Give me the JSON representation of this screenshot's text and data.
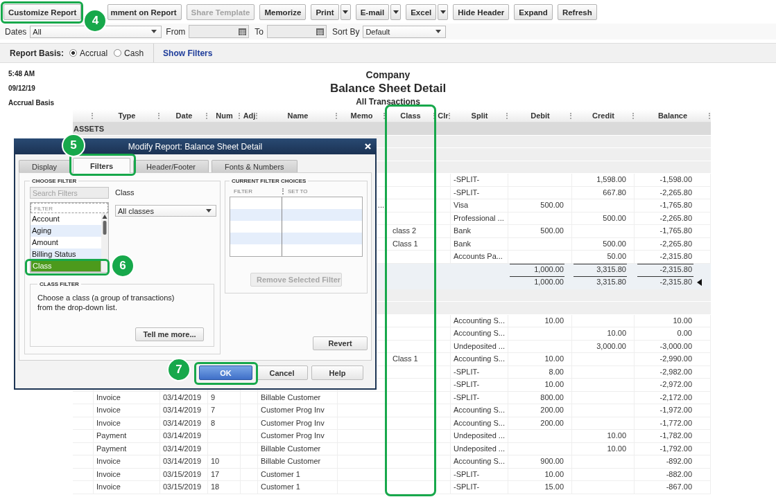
{
  "toolbar": {
    "buttons": [
      {
        "label": "Customize Report",
        "kind": "plain",
        "disabled": false,
        "highlighted": true,
        "step": "4"
      },
      {
        "label": "mment on Report",
        "kind": "plain",
        "disabled": false,
        "highlighted": false
      },
      {
        "label": "Share Template",
        "kind": "plain",
        "disabled": true,
        "highlighted": false
      },
      {
        "label": "Memorize",
        "kind": "plain",
        "disabled": false,
        "highlighted": false
      },
      {
        "label": "Print",
        "kind": "split",
        "disabled": false,
        "highlighted": false
      },
      {
        "label": "E-mail",
        "kind": "split",
        "disabled": false,
        "highlighted": false
      },
      {
        "label": "Excel",
        "kind": "split",
        "disabled": false,
        "highlighted": false
      },
      {
        "label": "Hide Header",
        "kind": "plain",
        "disabled": false,
        "highlighted": false
      },
      {
        "label": "Expand",
        "kind": "plain",
        "disabled": false,
        "highlighted": false
      },
      {
        "label": "Refresh",
        "kind": "plain",
        "disabled": false,
        "highlighted": false
      }
    ]
  },
  "filter_bar": {
    "dates": {
      "label": "Dates",
      "value": "All"
    },
    "from": {
      "label": "From"
    },
    "to": {
      "label": "To"
    },
    "sort_by": {
      "label": "Sort By",
      "value": "Default"
    }
  },
  "report_basis": {
    "label": "Report Basis:",
    "options": [
      {
        "label": "Accrual",
        "selected": true
      },
      {
        "label": "Cash",
        "selected": false
      }
    ],
    "link": "Show Filters"
  },
  "report": {
    "time": "5:48 AM",
    "date": "09/12/19",
    "basis": "Accrual Basis",
    "company": "Company",
    "title": "Balance Sheet Detail",
    "subtitle": "All Transactions"
  },
  "table": {
    "columns": [
      {
        "label": "Type",
        "highlighted": false
      },
      {
        "label": "Date",
        "highlighted": false
      },
      {
        "label": "Num",
        "highlighted": false
      },
      {
        "label": "Adj",
        "highlighted": false
      },
      {
        "label": "Name",
        "highlighted": false
      },
      {
        "label": "Memo",
        "highlighted": false
      },
      {
        "label": "Class",
        "highlighted": true
      },
      {
        "label": "Clr",
        "highlighted": false
      },
      {
        "label": "Split",
        "highlighted": false
      },
      {
        "label": "Debit",
        "highlighted": false
      },
      {
        "label": "Credit",
        "highlighted": false
      },
      {
        "label": "Balance",
        "highlighted": false
      }
    ],
    "rows": [
      {
        "kind": "section",
        "label": "ASSETS"
      },
      {
        "kind": "group"
      },
      {
        "kind": "group"
      },
      {
        "kind": "group"
      },
      {
        "kind": "detail",
        "split": "-SPLIT-",
        "credit": "1,598.00",
        "balance": "-1,598.00"
      },
      {
        "kind": "detail",
        "split": "-SPLIT-",
        "credit": "667.80",
        "balance": "-2,265.80"
      },
      {
        "kind": "detail",
        "memo": "...",
        "split": "Visa",
        "debit": "500.00",
        "balance": "-1,765.80"
      },
      {
        "kind": "detail",
        "split": "Professional ...",
        "credit": "500.00",
        "balance": "-2,265.80"
      },
      {
        "kind": "detail",
        "class": "class 2",
        "split": "Bank",
        "debit": "500.00",
        "balance": "-1,765.80"
      },
      {
        "kind": "detail",
        "class": "Class 1",
        "split": "Bank",
        "credit": "500.00",
        "balance": "-2,265.80"
      },
      {
        "kind": "detail",
        "split": "Accounts Pa...",
        "credit": "50.00",
        "balance": "-2,315.80"
      },
      {
        "kind": "subtotal",
        "debit": "1,000.00",
        "credit": "3,315.80",
        "balance": "-2,315.80"
      },
      {
        "kind": "total",
        "debit": "1,000.00",
        "credit": "3,315.80",
        "balance": "-2,315.80"
      },
      {
        "kind": "group"
      },
      {
        "kind": "group"
      },
      {
        "kind": "detail",
        "split": "Accounting S...",
        "debit": "10.00",
        "balance": "10.00"
      },
      {
        "kind": "detail",
        "split": "Accounting S...",
        "credit": "10.00",
        "balance": "0.00"
      },
      {
        "kind": "detail",
        "split": "Undeposited ...",
        "credit": "3,000.00",
        "balance": "-3,000.00"
      },
      {
        "kind": "detail",
        "class": "Class 1",
        "split": "Accounting S...",
        "debit": "10.00",
        "balance": "-2,990.00"
      },
      {
        "kind": "detail",
        "split": "-SPLIT-",
        "debit": "8.00",
        "balance": "-2,982.00"
      },
      {
        "kind": "detail",
        "split": "-SPLIT-",
        "debit": "10.00",
        "balance": "-2,972.00"
      },
      {
        "kind": "detail",
        "type": "Invoice",
        "date": "03/14/2019",
        "num": "9",
        "name": "Billable Customer",
        "split": "-SPLIT-",
        "debit": "800.00",
        "balance": "-2,172.00"
      },
      {
        "kind": "detail",
        "type": "Invoice",
        "date": "03/14/2019",
        "num": "7",
        "name": "Customer Prog Inv",
        "split": "Accounting S...",
        "debit": "200.00",
        "balance": "-1,972.00"
      },
      {
        "kind": "detail",
        "type": "Invoice",
        "date": "03/14/2019",
        "num": "8",
        "name": "Customer Prog Inv",
        "split": "Accounting S...",
        "debit": "200.00",
        "balance": "-1,772.00"
      },
      {
        "kind": "detail",
        "type": "Payment",
        "date": "03/14/2019",
        "name": "Customer Prog Inv",
        "split": "Undeposited ...",
        "credit": "10.00",
        "balance": "-1,782.00"
      },
      {
        "kind": "detail",
        "type": "Payment",
        "date": "03/14/2019",
        "name": "Billable Customer",
        "split": "Undeposited ...",
        "credit": "10.00",
        "balance": "-1,792.00"
      },
      {
        "kind": "detail",
        "type": "Invoice",
        "date": "03/14/2019",
        "num": "10",
        "name": "Billable Customer",
        "split": "Accounting S...",
        "debit": "900.00",
        "balance": "-892.00"
      },
      {
        "kind": "detail",
        "type": "Invoice",
        "date": "03/15/2019",
        "num": "17",
        "name": "Customer 1",
        "split": "-SPLIT-",
        "debit": "10.00",
        "balance": "-882.00"
      },
      {
        "kind": "detail",
        "type": "Invoice",
        "date": "03/15/2019",
        "num": "18",
        "name": "Customer 1",
        "split": "-SPLIT-",
        "debit": "15.00",
        "balance": "-867.00"
      }
    ]
  },
  "dialog": {
    "title": "Modify Report: Balance Sheet Detail",
    "tabs": [
      {
        "label": "Display",
        "selected": false,
        "highlighted": false
      },
      {
        "label": "Filters",
        "selected": true,
        "highlighted": true,
        "step": "5"
      },
      {
        "label": "Header/Footer",
        "selected": false,
        "highlighted": false
      },
      {
        "label": "Fonts & Numbers",
        "selected": false,
        "highlighted": false
      }
    ],
    "choose_filter": {
      "heading": "CHOOSE FILTER",
      "search": {
        "placeholder": "Search Filters"
      },
      "list_header": "FILTER",
      "items": [
        {
          "label": "Account",
          "selected": false,
          "highlighted": false
        },
        {
          "label": "Aging",
          "selected": false,
          "highlighted": false
        },
        {
          "label": "Amount",
          "selected": false,
          "highlighted": false
        },
        {
          "label": "Billing Status",
          "selected": false,
          "highlighted": false
        },
        {
          "label": "Class",
          "selected": true,
          "highlighted": true,
          "step": "6"
        }
      ],
      "field_label": "Class",
      "value": "All classes"
    },
    "class_filter": {
      "heading": "CLASS FILTER",
      "text": "Choose a class (a group of transactions) from the drop-down list.",
      "button": "Tell me more..."
    },
    "current_filters": {
      "heading": "CURRENT FILTER CHOICES",
      "columns": [
        "FILTER",
        "SET TO"
      ],
      "remove_button": {
        "label": "Remove Selected Filter",
        "disabled": true
      }
    },
    "revert_button": "Revert",
    "buttons": [
      {
        "label": "OK",
        "kind": "primary",
        "highlighted": true,
        "step": "7"
      },
      {
        "label": "Cancel",
        "kind": "plain",
        "highlighted": false
      },
      {
        "label": "Help",
        "kind": "plain",
        "highlighted": false
      }
    ]
  }
}
